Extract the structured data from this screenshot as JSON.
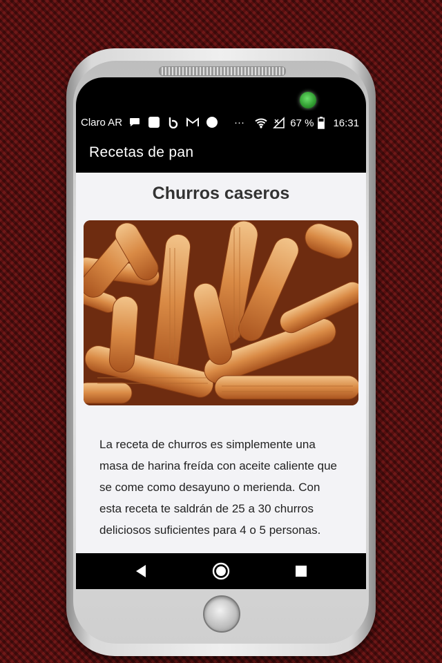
{
  "status_bar": {
    "carrier": "Claro AR",
    "battery": "67 %",
    "time": "16:31",
    "more": "···"
  },
  "app_bar": {
    "title": "Recetas de pan"
  },
  "recipe": {
    "title": "Churros caseros",
    "image_alt": "churros fritos",
    "description": "La receta de churros es simplemente una masa de harina freída con aceite caliente que se come como desayuno o merienda. Con esta receta te saldrán de 25 a 30 churros deliciosos suficientes para 4 o 5 personas."
  },
  "icons": {
    "status": [
      "chat-bubble-icon",
      "square-icon",
      "b-logo-icon",
      "gmail-icon",
      "circle-icon",
      "wifi-icon",
      "signal-icon",
      "battery-icon"
    ],
    "nav": [
      "back-icon",
      "home-icon",
      "recents-icon"
    ]
  },
  "colors": {
    "background": "#5a0f0f",
    "bar": "#000000",
    "screen": "#f3f3f6",
    "text": "#333333"
  }
}
